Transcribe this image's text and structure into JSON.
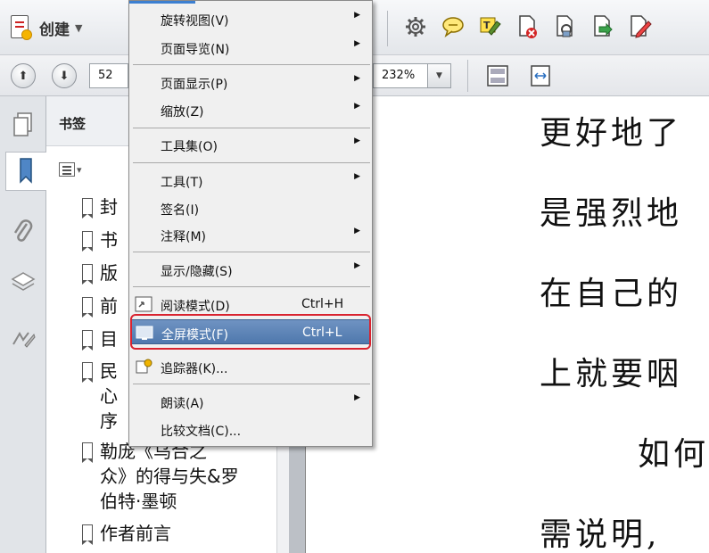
{
  "toolbar": {
    "create_label": "创建",
    "page_number": "52",
    "zoom": "232%"
  },
  "panel": {
    "title": "书签",
    "bookmarks": [
      {
        "text": "封"
      },
      {
        "text": "书"
      },
      {
        "text": "版"
      },
      {
        "text": "前"
      },
      {
        "text": "目"
      },
      {
        "lines": [
          "民",
          "心",
          "序"
        ]
      },
      {
        "lines": [
          "勒庞《乌合之",
          "众》的得与失&罗",
          "伯特·墨顿"
        ]
      },
      {
        "text": "作者前言"
      }
    ]
  },
  "document": {
    "lines": [
      "更好地了",
      "是强烈地",
      "在自己的",
      "上就要咽",
      "如何",
      "需说明,"
    ]
  },
  "menu": {
    "items": [
      {
        "label": "旋转视图(V)",
        "submenu": true
      },
      {
        "label": "页面导览(N)",
        "submenu": true
      },
      {
        "label": "页面显示(P)",
        "submenu": true
      },
      {
        "label": "缩放(Z)",
        "submenu": true
      },
      {
        "label": "工具集(O)",
        "submenu": true
      },
      {
        "label": "工具(T)",
        "submenu": true
      },
      {
        "label": "签名(I)",
        "submenu": false
      },
      {
        "label": "注释(M)",
        "submenu": true
      },
      {
        "label": "显示/隐藏(S)",
        "submenu": true
      },
      {
        "label": "阅读模式(D)",
        "shortcut": "Ctrl+H"
      },
      {
        "label": "全屏模式(F)",
        "shortcut": "Ctrl+L",
        "highlighted": true
      },
      {
        "label": "追踪器(K)...",
        "submenu": false
      },
      {
        "label": "朗读(A)",
        "submenu": true
      },
      {
        "label": "比较文档(C)...",
        "submenu": false
      }
    ]
  },
  "colors": {
    "highlight": "#4f78ad",
    "annotation_ring": "#d9232f",
    "menu_top_accent": "#3c7fd1"
  }
}
